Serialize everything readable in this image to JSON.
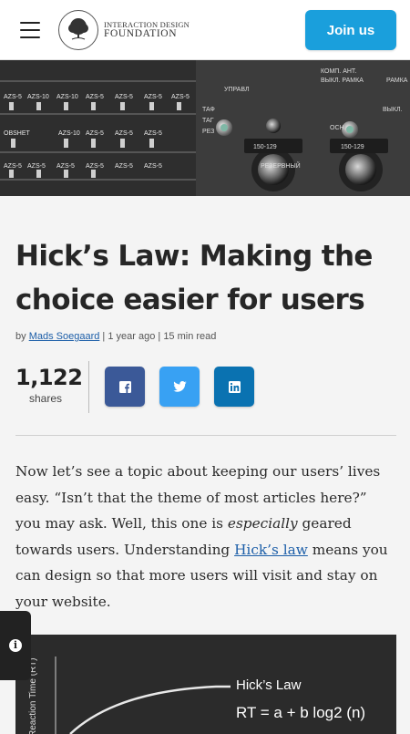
{
  "header": {
    "logo_line1": "INTERACTION DESIGN",
    "logo_line2": "FOUNDATION",
    "join_label": "Join us"
  },
  "colors": {
    "accent": "#1a9fdc",
    "facebook": "#3b5998",
    "twitter": "#38a1f3",
    "linkedin": "#0a72b1",
    "link": "#1c5ea8"
  },
  "article": {
    "title_line1": "Hick’s Law: Making the",
    "title_line2": "choice easier for users",
    "byline_prefix": "by",
    "author": "Mads Soegaard",
    "separator1": "|",
    "age": "1 year ago",
    "separator2": "|",
    "read_time": "15 min read"
  },
  "share": {
    "count": "1,122",
    "label": "shares",
    "icons": [
      "facebook-icon",
      "twitter-icon",
      "linkedin-icon"
    ]
  },
  "body": {
    "p1_a": "Now let’s see a topic about keeping our users’ lives easy. “Isn’t that the theme of most articles here?” you may ask. Well, this one is ",
    "p1_em": "especially",
    "p1_b": " geared towards users. Understanding ",
    "p1_link": "Hick’s law",
    "p1_c": " means you can design so that more users will visit and stay on your website."
  },
  "figure": {
    "label": "Hick’s Law",
    "formula": "RT = a + b log2 (n)",
    "ylabel": "Reaction Time (RT)"
  },
  "info_tab": {
    "icon": "info-icon",
    "glyph": "i"
  }
}
